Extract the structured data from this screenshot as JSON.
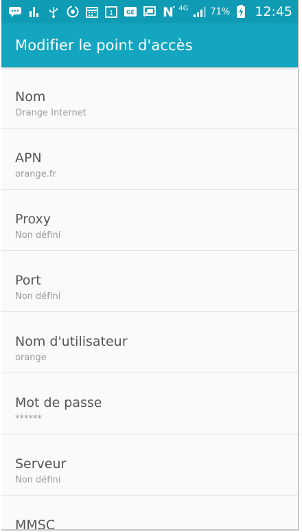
{
  "status_bar": {
    "network_label": "4G",
    "battery_percent": "71%",
    "time": "12:45",
    "icons": [
      "chat-icon",
      "bars-chart-icon",
      "usb-icon",
      "sync-icon",
      "calendar-icon",
      "calendar-day-icon",
      "ge-icon",
      "cast-icon",
      "n-icon",
      "signal-icon",
      "battery-charging-icon"
    ],
    "calendar_day": "1",
    "ge_text": "GE",
    "n_text": "N"
  },
  "app_bar": {
    "title": "Modifier le point d'accès"
  },
  "settings": [
    {
      "label": "Nom",
      "value": "Orange Internet"
    },
    {
      "label": "APN",
      "value": "orange.fr"
    },
    {
      "label": "Proxy",
      "value": "Non défini"
    },
    {
      "label": "Port",
      "value": "Non défini"
    },
    {
      "label": "Nom d'utilisateur",
      "value": "orange"
    },
    {
      "label": "Mot de passe",
      "value": "******"
    },
    {
      "label": "Serveur",
      "value": "Non défini"
    },
    {
      "label": "MMSC",
      "value": ""
    }
  ],
  "colors": {
    "status_bar": "#0f9bb4",
    "app_bar": "#14a6c1"
  }
}
